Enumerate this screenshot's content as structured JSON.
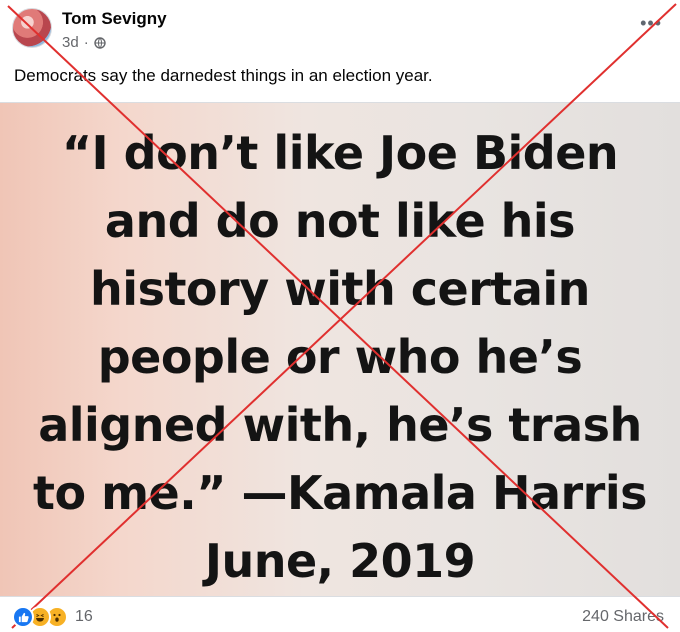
{
  "post": {
    "author": "Tom Sevigny",
    "time": "3d",
    "separator": "·",
    "privacy_icon": "globe-icon",
    "more_icon": "ellipsis-icon",
    "text": "Democrats say the darnedest things in an election year."
  },
  "meme": {
    "lines": [
      "“I don’t like Joe Biden",
      "and do not like his",
      "history with certain",
      "people or who he’s",
      "aligned with, he’s trash",
      "to me.” —Kamala Harris",
      "June, 2019"
    ]
  },
  "footer": {
    "reaction_icons": [
      "like-icon",
      "haha-icon",
      "wow-icon"
    ],
    "reaction_count": "16",
    "shares": "240 Shares"
  },
  "overlay": {
    "type": "red-x",
    "color": "#e0302f"
  }
}
